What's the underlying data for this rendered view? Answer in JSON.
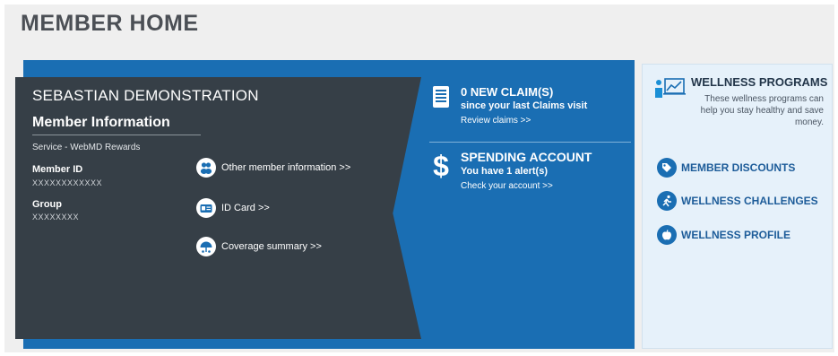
{
  "page": {
    "title": "MEMBER HOME"
  },
  "member": {
    "name": "SEBASTIAN DEMONSTRATION",
    "section_title": "Member Information",
    "service": "Service - WebMD Rewards",
    "member_id_label": "Member ID",
    "member_id_value": "XXXXXXXXXXXX",
    "group_label": "Group",
    "group_value": "XXXXXXXX",
    "links": {
      "other_info": "Other member information >>",
      "id_card": "ID Card >>",
      "coverage": "Coverage summary >>"
    }
  },
  "claims": {
    "title": "0 NEW CLAIM(S)",
    "subtitle": "since your last Claims visit",
    "link": "Review claims >>"
  },
  "spending": {
    "title": "SPENDING ACCOUNT",
    "subtitle": "You have 1 alert(s)",
    "link": "Check your account >>"
  },
  "wellness": {
    "title": "WELLNESS PROGRAMS",
    "description": "These wellness programs can help you stay healthy and save money.",
    "links": {
      "discounts": "MEMBER DISCOUNTS",
      "challenges": "WELLNESS CHALLENGES",
      "profile": "WELLNESS PROFILE"
    }
  },
  "icons": {
    "people": "people-icon",
    "id_card": "id-card-icon",
    "coverage": "umbrella-icon",
    "claims": "document-list-icon",
    "spending": "dollar-icon",
    "wellness": "wellness-chart-icon",
    "discount": "tag-icon",
    "challenge": "runner-icon",
    "profile": "apple-icon"
  },
  "colors": {
    "primary_blue": "#1a6eb3",
    "dark_panel": "#363f47",
    "wellness_bg": "#e6f1fa",
    "link_blue": "#1d5c99"
  }
}
